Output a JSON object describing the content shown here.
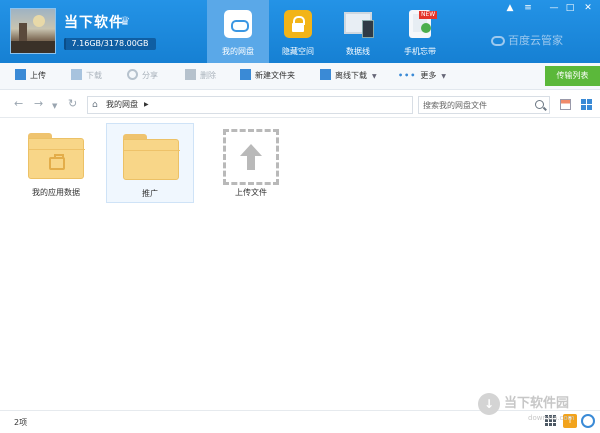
{
  "header": {
    "username": "当下软件",
    "storage_text": "7.16GB/3178.00GB",
    "storage_used_fraction": 0.0023,
    "nav": [
      {
        "label": "我的网盘",
        "icon": "cloud-icon",
        "active": true
      },
      {
        "label": "隐藏空间",
        "icon": "lock-icon",
        "active": false
      },
      {
        "label": "数据线",
        "icon": "devices-icon",
        "active": false
      },
      {
        "label": "手机忘带",
        "icon": "phone-icon",
        "active": false,
        "badge": "NEW"
      }
    ],
    "brand": "百度云管家",
    "colors": {
      "header": "#1e87d9",
      "transfer": "#5bb83a"
    }
  },
  "toolbar": {
    "upload": "上传",
    "download": "下载",
    "share": "分享",
    "delete": "删除",
    "new_folder": "新建文件夹",
    "offline_download": "离线下载",
    "more": "更多",
    "transfer_list": "传输列表"
  },
  "address": {
    "breadcrumb": "我的网盘",
    "search_placeholder": "搜索我的网盘文件"
  },
  "files": [
    {
      "name": "我的应用数据",
      "type": "folder",
      "icon": "briefcase-icon"
    },
    {
      "name": "推广",
      "type": "folder",
      "selected": true
    },
    {
      "name": "上传文件",
      "type": "upload"
    }
  ],
  "status": {
    "count": "2项"
  },
  "watermark": {
    "text": "当下软件园",
    "sub": "downxia.com"
  }
}
